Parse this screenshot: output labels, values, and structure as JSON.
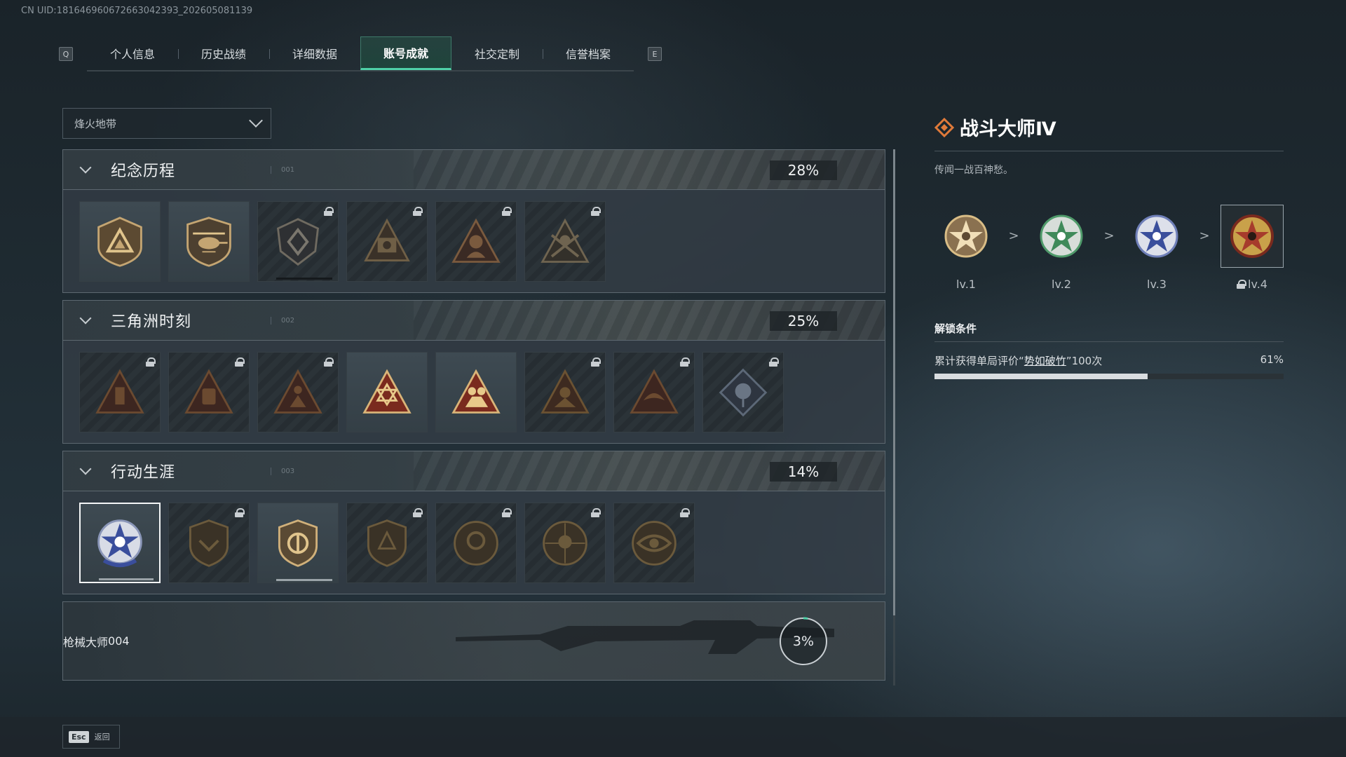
{
  "uid_text": "CN UID:18164696067266304239З_202605081139",
  "tabs": {
    "left_key": "Q",
    "right_key": "E",
    "items": [
      "个人信息",
      "历史战绩",
      "详细数据",
      "账号成就",
      "社交定制",
      "信誉档案"
    ],
    "active_index": 3
  },
  "filter": {
    "selected": "烽火地带"
  },
  "sections": [
    {
      "title": "纪念历程",
      "index": "001",
      "percent": "28%",
      "expanded": true,
      "badges_locked": [
        false,
        false,
        true,
        true,
        true,
        true
      ]
    },
    {
      "title": "三角洲时刻",
      "index": "002",
      "percent": "25%",
      "expanded": true,
      "badges_locked": [
        true,
        true,
        true,
        false,
        false,
        true,
        true,
        true
      ]
    },
    {
      "title": "行动生涯",
      "index": "003",
      "percent": "14%",
      "expanded": true,
      "badges_locked": [
        false,
        true,
        false,
        true,
        true,
        true,
        true
      ],
      "selected_badge": 0
    },
    {
      "title": "枪械大师",
      "index": "004",
      "percent": "3%",
      "progress_fraction": 0.03,
      "expanded": false
    }
  ],
  "detail": {
    "name": "战斗大师Ⅳ",
    "description": "传闻一战百神愁。",
    "levels": [
      {
        "label": "lv.1",
        "locked": false,
        "color": "#c9a46a"
      },
      {
        "label": "lv.2",
        "locked": false,
        "color": "#4f9a6a"
      },
      {
        "label": "lv.3",
        "locked": false,
        "color": "#6f7fb8"
      },
      {
        "label": "lv.4",
        "locked": true,
        "color": "#a63b2c"
      }
    ],
    "selected_level": 3,
    "level_arrow": ">",
    "unlock_title": "解锁条件",
    "condition_prefix": "累计获得单局评价“",
    "condition_highlight": "势如破竹",
    "condition_suffix": "”100次",
    "condition_percent": "61%",
    "condition_progress": 0.61
  },
  "footer": {
    "esc_key": "Esc",
    "back_label": "返回"
  },
  "colors": {
    "accent": "#4fd1a8",
    "diamond": "#e07a3a"
  }
}
